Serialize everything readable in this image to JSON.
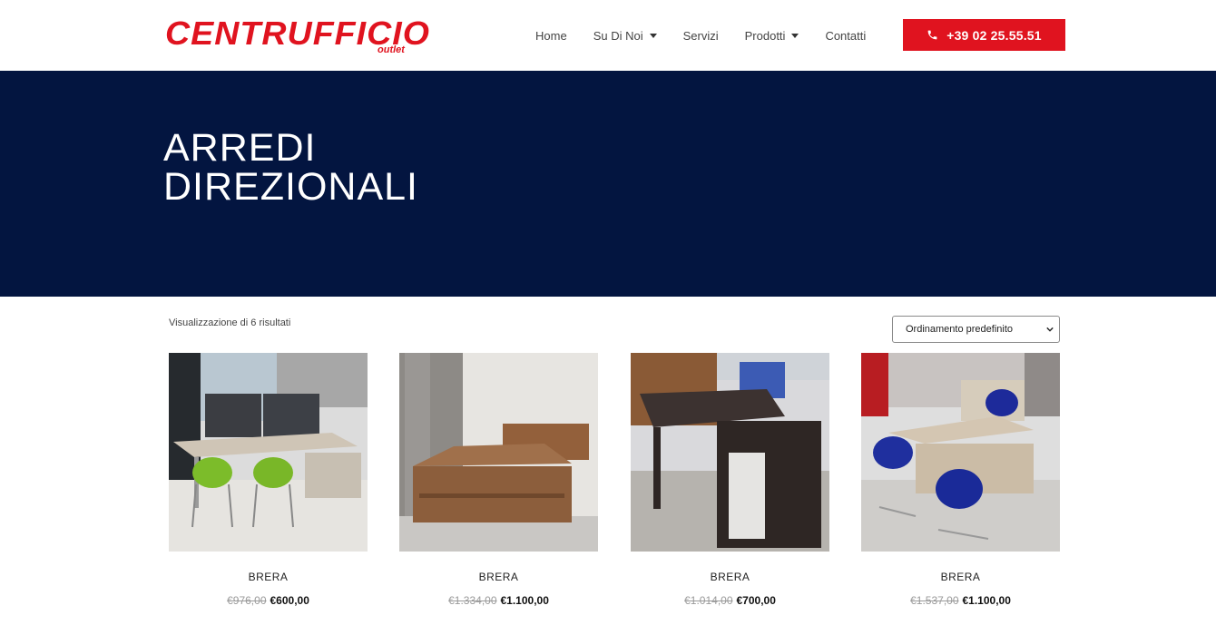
{
  "header": {
    "logo_text": "CENTRUFFICIO",
    "logo_sub": "outlet",
    "nav": [
      {
        "label": "Home",
        "has_dropdown": false
      },
      {
        "label": "Su Di Noi",
        "has_dropdown": true
      },
      {
        "label": "Servizi",
        "has_dropdown": false
      },
      {
        "label": "Prodotti",
        "has_dropdown": true
      },
      {
        "label": "Contatti",
        "has_dropdown": false
      }
    ],
    "phone": "+39 02 25.55.51",
    "phone_icon": "phone-icon",
    "accent_color": "#e0131f"
  },
  "hero": {
    "title_line1": "ARREDI",
    "title_line2": "DIREZIONALI",
    "background_color": "#031540"
  },
  "shop": {
    "result_count": "Visualizzazione di 6 risultati",
    "sort_selected": "Ordinamento predefinito"
  },
  "products": [
    {
      "name": "BRERA",
      "old_price": "€976,00",
      "price": "€600,00"
    },
    {
      "name": "BRERA",
      "old_price": "€1.334,00",
      "price": "€1.100,00"
    },
    {
      "name": "BRERA",
      "old_price": "€1.014,00",
      "price": "€700,00"
    },
    {
      "name": "BRERA",
      "old_price": "€1.537,00",
      "price": "€1.100,00"
    }
  ]
}
